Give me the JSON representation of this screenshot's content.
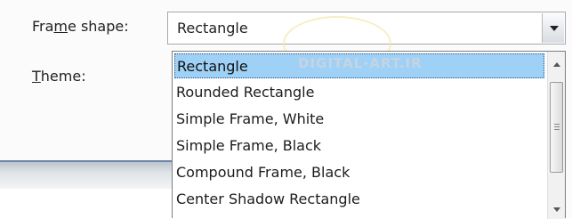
{
  "labels": {
    "frame_shape_pre": "Fra",
    "frame_shape_accel": "m",
    "frame_shape_post": "e shape:",
    "theme_accel": "T",
    "theme_post": "heme:"
  },
  "frame_shape_combo": {
    "value": "Rectangle",
    "icon": "chevron-down-icon"
  },
  "dropdown": {
    "items": [
      "Rectangle",
      "Rounded Rectangle",
      "Simple Frame, White",
      "Simple Frame, Black",
      "Compound Frame, Black",
      "Center Shadow Rectangle"
    ],
    "selected_index": 0
  },
  "watermark_text": "DIGITAL-ART.IR",
  "colors": {
    "selection": "#9fd0f5",
    "accent_border": "#6d87a6"
  }
}
